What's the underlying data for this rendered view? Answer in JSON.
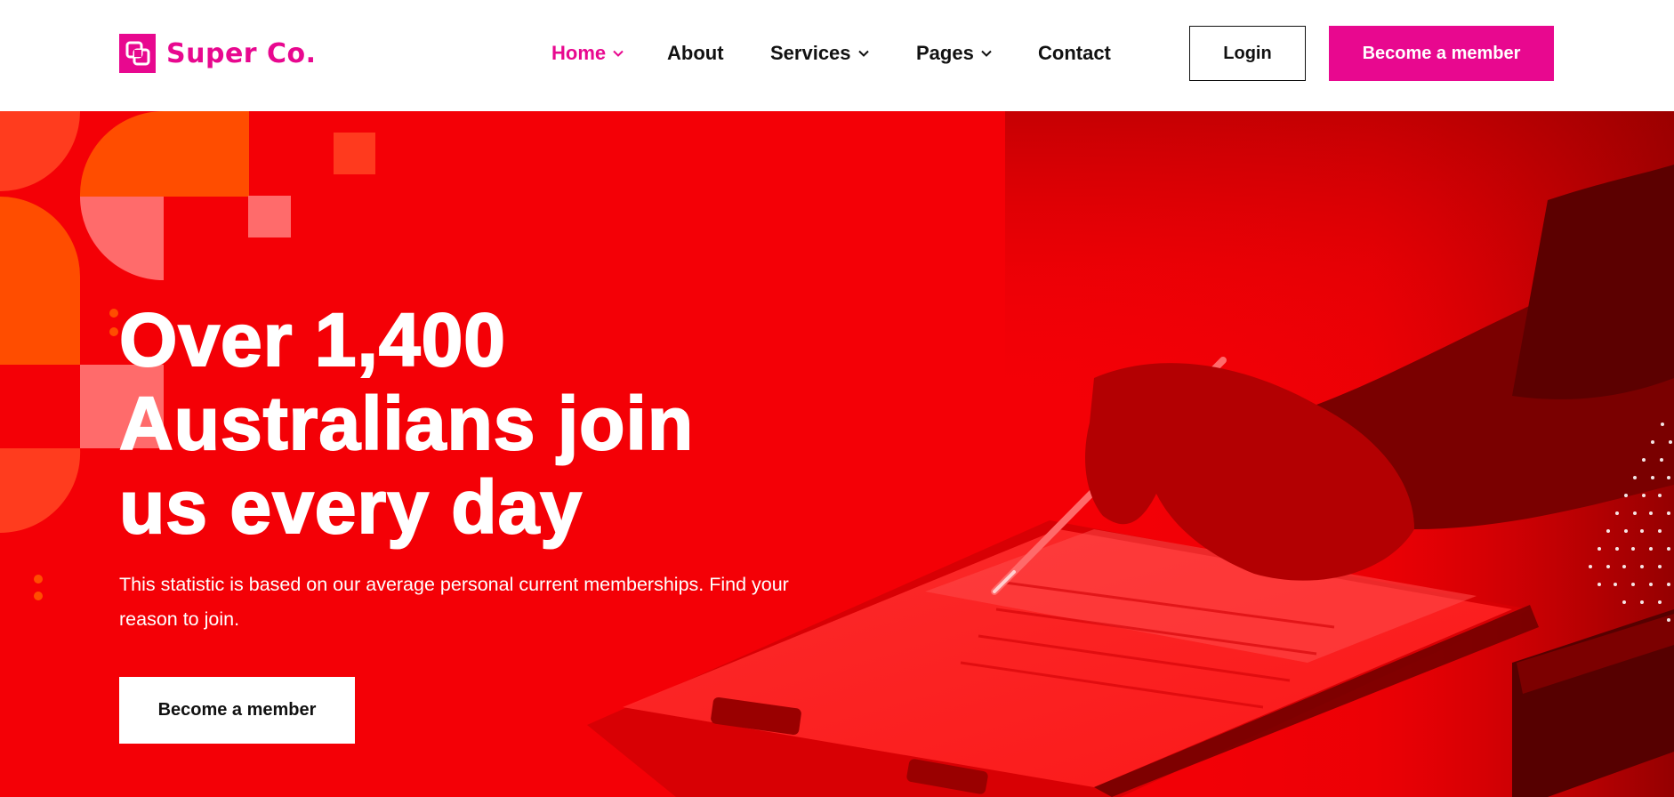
{
  "brand": {
    "name": "Super Co.",
    "color": "#e8088f",
    "logo_icon": "linked-squares-icon"
  },
  "nav": {
    "items": [
      {
        "label": "Home",
        "active": true,
        "has_dropdown": true
      },
      {
        "label": "About",
        "active": false,
        "has_dropdown": false
      },
      {
        "label": "Services",
        "active": false,
        "has_dropdown": true
      },
      {
        "label": "Pages",
        "active": false,
        "has_dropdown": true
      },
      {
        "label": "Contact",
        "active": false,
        "has_dropdown": false
      }
    ],
    "dropdown_icon": "chevron-down-icon"
  },
  "header_actions": {
    "login_label": "Login",
    "member_label": "Become a member"
  },
  "hero": {
    "title_lines": [
      "Over 1,400",
      "Australians join",
      "us every day"
    ],
    "subtitle": "This statistic is based on our average personal current memberships. Find your reason to join.",
    "cta_label": "Become a member",
    "background_color": "#f40006",
    "accent_color": "#ff5a00"
  }
}
